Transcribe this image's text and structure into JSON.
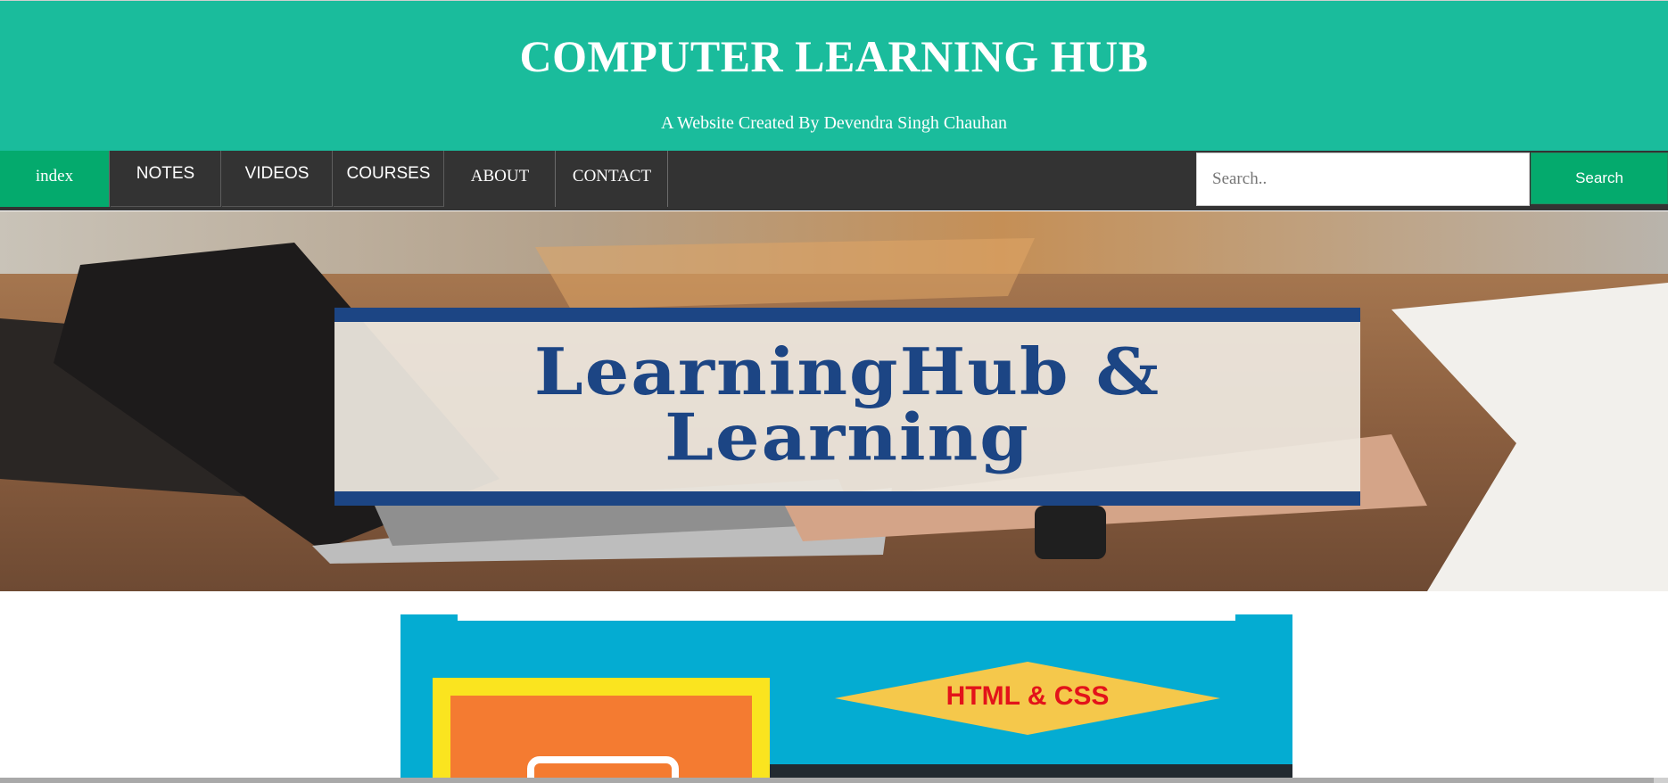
{
  "header": {
    "title": "COMPUTER LEARNING HUB",
    "subtitle": "A Website Created By Devendra Singh Chauhan"
  },
  "nav": {
    "items": [
      {
        "label": "index",
        "active": true
      },
      {
        "label": "NOTES"
      },
      {
        "label": "VIDEOS"
      },
      {
        "label": "COURSES"
      },
      {
        "label": "ABOUT"
      },
      {
        "label": "CONTACT"
      }
    ]
  },
  "search": {
    "placeholder": "Search..",
    "value": "",
    "button_label": "Search"
  },
  "hero": {
    "banner_line1": "LearningHub &",
    "banner_line2": "Learning",
    "backdrop_icon": "laptop-desk-photo"
  },
  "promo": {
    "label": "HTML & CSS",
    "icon": "monitor-icon"
  },
  "colors": {
    "header_bg": "#1abc9c",
    "nav_bg": "#333333",
    "accent": "#04aa6d",
    "banner_blue": "#1c4584",
    "promo_bg": "#04acd2",
    "promo_yellow": "#fae41f",
    "promo_orange": "#f47b31",
    "promo_diamond": "#f5c84b",
    "promo_text": "#e3131a"
  }
}
